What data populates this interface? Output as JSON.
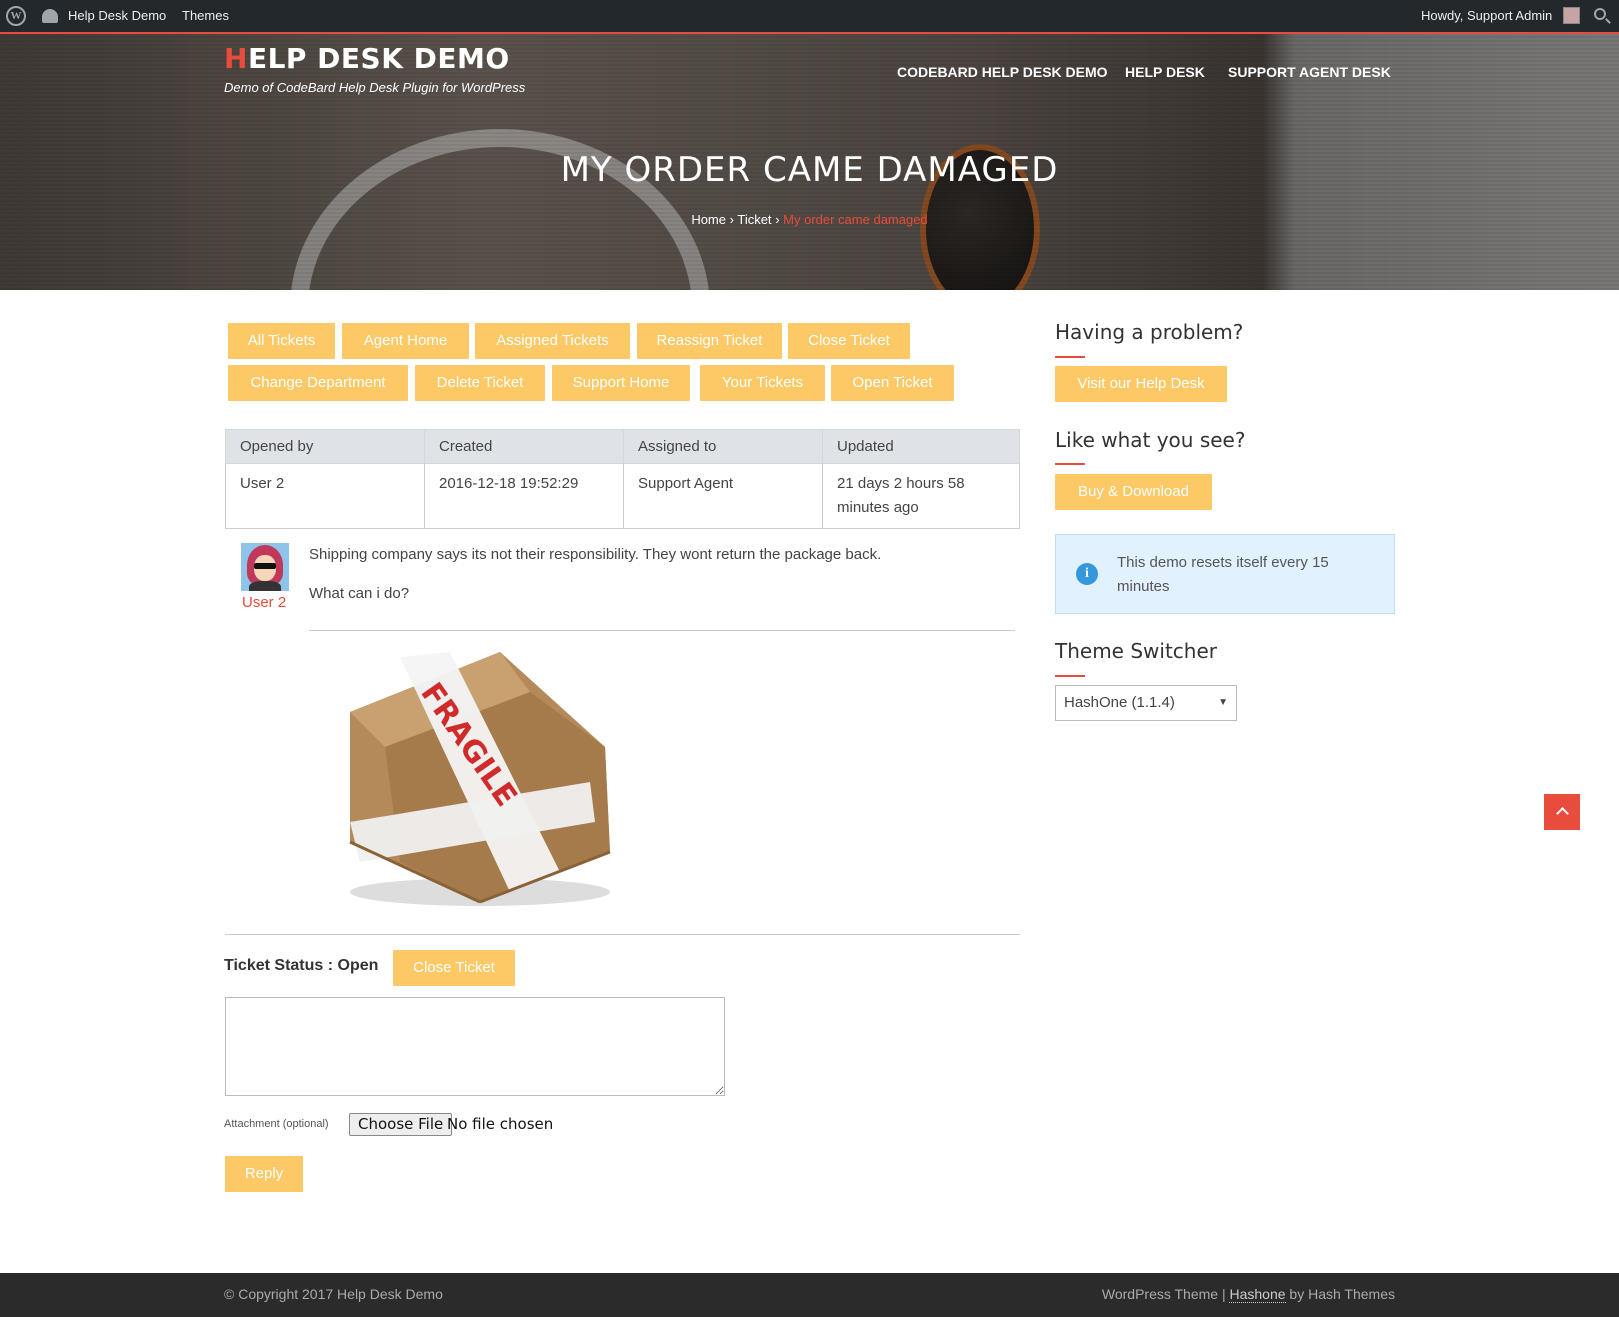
{
  "adminbar": {
    "site": "Help Desk Demo",
    "themes": "Themes",
    "howdy": "Howdy, Support Admin"
  },
  "header": {
    "title_first": "H",
    "title_rest": "ELP DESK DEMO",
    "tagline": "Demo of CodeBard Help Desk Plugin for WordPress",
    "nav": [
      "CODEBARD HELP DESK DEMO",
      "HELP DESK",
      "SUPPORT AGENT DESK"
    ]
  },
  "page": {
    "title": "MY ORDER CAME DAMAGED",
    "breadcrumb": {
      "home": "Home",
      "sep": "›",
      "ticket": "Ticket",
      "current": "My order came damaged"
    }
  },
  "ticket_nav": {
    "row1": [
      "All Tickets",
      "Agent Home",
      "Assigned Tickets",
      "Reassign Ticket",
      "Close Ticket"
    ],
    "row2": [
      "Change Department",
      "Delete Ticket",
      "Support Home",
      "Your Tickets",
      "Open Ticket"
    ]
  },
  "ticket_info": {
    "headers": [
      "Opened by",
      "Created",
      "Assigned to",
      "Updated"
    ],
    "values": [
      "User 2",
      "2016-12-18 19:52:29",
      "Support Agent",
      "21 days 2 hours 58 minutes ago"
    ]
  },
  "message": {
    "author": "User 2",
    "line1": "Shipping company says its not their responsibility. They wont return the package back.",
    "line2": "What can i do?",
    "attachment_text": "FRAGILE"
  },
  "reply": {
    "status_label": "Ticket Status : Open",
    "close_button": "Close Ticket",
    "attachment_label": "Attachment (optional)",
    "choose_file": "Choose File",
    "no_file": "No file chosen",
    "reply_button": "Reply"
  },
  "sidebar": {
    "problem_heading": "Having a problem?",
    "help_button": "Visit our Help Desk",
    "like_heading": "Like what you see?",
    "buy_button": "Buy & Download",
    "notice": "This demo resets itself every 15 minutes",
    "theme_heading": "Theme Switcher",
    "theme_selected": "HashOne (1.1.4)"
  },
  "footer": {
    "copyright": "© Copyright 2017 Help Desk Demo",
    "credit_pre": "WordPress Theme |",
    "credit_link": "Hashone",
    "credit_post": "by Hash Themes"
  },
  "colors": {
    "accent": "#e74c3c",
    "button": "#fdc866",
    "admin_bar": "#23282d",
    "footer": "#2b2b2b"
  }
}
